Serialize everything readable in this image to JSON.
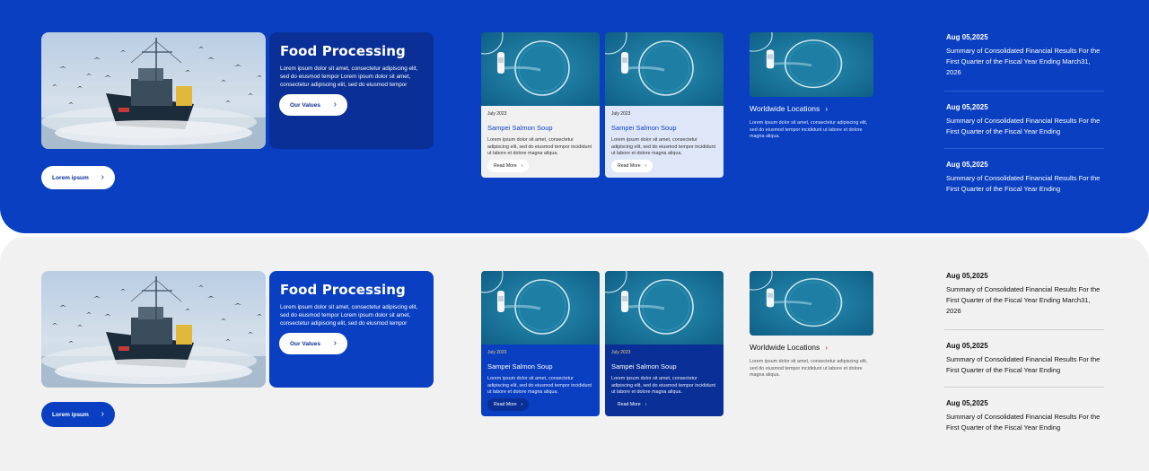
{
  "panels": [
    {
      "theme": "blue",
      "hero_alt": "fishing-boat-with-seagulls",
      "food_card": {
        "title": "Food Processing",
        "text": "Lorem ipsum dolor sit amet, consectetur adipiscing elit, sed do eiusmod tempor Lorem ipsum dolor sit amet, consectetur adipiscing elit, sed do eiusmod tempor",
        "button": "Our Values"
      },
      "cta_button": "Lorem ipsum",
      "news_cards": [
        {
          "date": "July 2023",
          "title": "Sampei Salmon Soup",
          "text": "Lorem ipsum dolor sit amet, consectetur adipiscing elit, sed do eiusmod tempor incididunt ut labore et dolore magna aliqua.",
          "button": "Read More"
        },
        {
          "date": "July 2023",
          "title": "Sampei Salmon Soup",
          "text": "Lorem ipsum dolor sit amet, consectetur adipiscing elit, sed do eiusmod tempor incididunt ut labore et dolore magna aliqua.",
          "button": "Read More"
        }
      ],
      "worldwide": {
        "title": "Worldwide Locations",
        "text": "Lorem ipsum dolor sit amet, consectetur adipiscing elit, sed do eiusmod tempor incididunt ut labore et dolore magna aliqua."
      },
      "news_list": [
        {
          "date": "Aug 05,2025",
          "title": "Summary of Consolidated Financial Results For the First Quarter of the Fiscal Year Ending March31, 2026"
        },
        {
          "date": "Aug 05,2025",
          "title": "Summary of Consolidated Financial Results For the First Quarter of the Fiscal Year Ending"
        },
        {
          "date": "Aug 05,2025",
          "title": "Summary of Consolidated Financial Results For the First Quarter of the Fiscal Year Ending"
        }
      ]
    },
    {
      "theme": "gray",
      "hero_alt": "fishing-boat-with-seagulls",
      "food_card": {
        "title": "Food Processing",
        "text": "Lorem ipsum dolor sit amet, consectetur adipiscing elit, sed do eiusmod tempor Lorem ipsum dolor sit amet, consectetur adipiscing elit, sed do eiusmod tempor",
        "button": "Our Values"
      },
      "cta_button": "Lorem ipsum",
      "news_cards": [
        {
          "date": "July 2023",
          "title": "Sampei Salmon Soup",
          "text": "Lorem ipsum dolor sit amet, consectetur adipiscing elit, sed do eiusmod tempor incididunt ut labore et dolore magna aliqua.",
          "button": "Read More"
        },
        {
          "date": "July 2023",
          "title": "Sampei Salmon Soup",
          "text": "Lorem ipsum dolor sit amet, consectetur adipiscing elit, sed do eiusmod tempor incididunt ut labore et dolore magna aliqua.",
          "button": "Read More"
        }
      ],
      "worldwide": {
        "title": "Worldwide Locations",
        "text": "Lorem ipsum dolor sit amet, consectetur adipiscing elit, sed do eiusmod tempor incididunt ut labore et dolore magna aliqua."
      },
      "news_list": [
        {
          "date": "Aug 05,2025",
          "title": "Summary of Consolidated Financial Results For the First Quarter of the Fiscal Year Ending March31, 2026"
        },
        {
          "date": "Aug 05,2025",
          "title": "Summary of Consolidated Financial Results For the First Quarter of the Fiscal Year Ending"
        },
        {
          "date": "Aug 05,2025",
          "title": "Summary of Consolidated Financial Results For the First Quarter of the Fiscal Year Ending"
        }
      ]
    }
  ],
  "icons": {
    "chevron": "chevron-right-icon"
  },
  "colors": {
    "brand_blue": "#0a3fc2",
    "dark_blue": "#0a2f96",
    "light_panel": "#f1f1f1"
  }
}
